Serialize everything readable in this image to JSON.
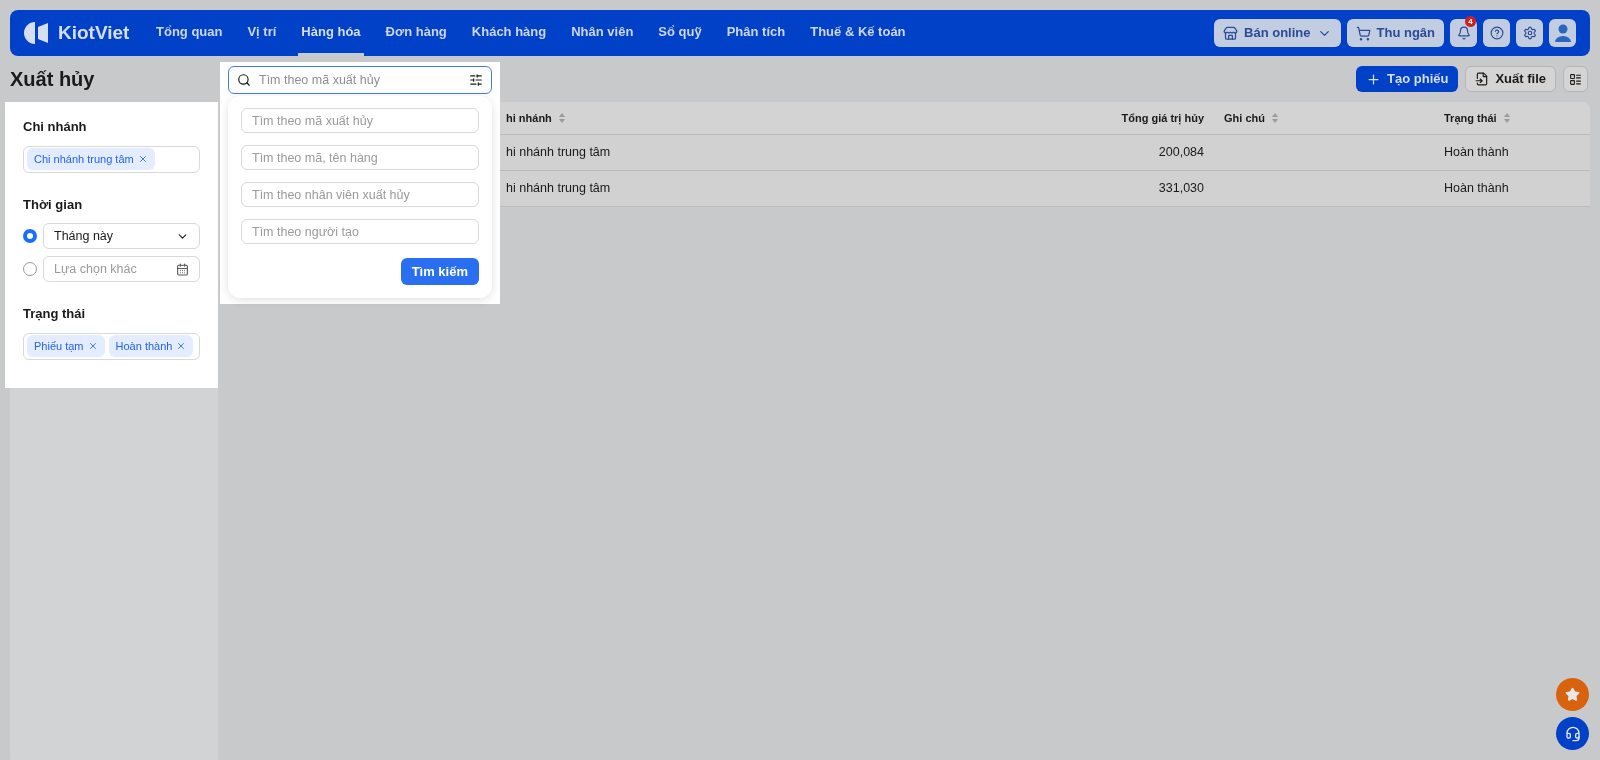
{
  "header": {
    "logo": "KiotViet",
    "nav": [
      {
        "label": "Tổng quan",
        "selected": false
      },
      {
        "label": "Vị trí",
        "selected": false
      },
      {
        "label": "Hàng hóa",
        "selected": true
      },
      {
        "label": "Đơn hàng",
        "selected": false
      },
      {
        "label": "Khách hàng",
        "selected": false
      },
      {
        "label": "Nhân viên",
        "selected": false
      },
      {
        "label": "Sổ quỹ",
        "selected": false
      },
      {
        "label": "Phân tích",
        "selected": false
      },
      {
        "label": "Thuế & Kế toán",
        "selected": false
      }
    ],
    "online_button": "Bán online",
    "cashier_button": "Thu ngân",
    "notification_count": "4"
  },
  "page_title": "Xuất hủy",
  "actions": {
    "create": "Tạo phiếu",
    "export": "Xuất file"
  },
  "filters": {
    "branch": {
      "label": "Chi nhánh",
      "tags": [
        "Chi nhánh trung tâm"
      ]
    },
    "time": {
      "label": "Thời gian",
      "options": [
        {
          "kind": "select",
          "value": "Tháng này",
          "selected": true
        },
        {
          "kind": "date",
          "placeholder": "Lựa chọn khác",
          "selected": false
        }
      ]
    },
    "status": {
      "label": "Trạng thái",
      "tags": [
        "Phiếu tạm",
        "Hoàn thành"
      ]
    }
  },
  "search_popup": {
    "search": {
      "placeholder": "Tìm theo mã xuất hủy"
    },
    "fields": [
      {
        "placeholder": "Tìm theo mã xuất hủy"
      },
      {
        "placeholder": "Tìm theo mã, tên hàng"
      },
      {
        "placeholder": "Tìm theo nhân viên xuất hủy"
      },
      {
        "placeholder": "Tìm theo người tạo"
      }
    ],
    "button": "Tìm kiếm"
  },
  "table": {
    "columns": [
      {
        "label": "hi nhánh",
        "kind": "text",
        "sortable": true
      },
      {
        "label": "Tổng giá trị hủy",
        "kind": "number",
        "sortable": false
      },
      {
        "label": "Ghi chú",
        "kind": "text",
        "sortable": true
      },
      {
        "label": "Trạng thái",
        "kind": "text",
        "sortable": true
      }
    ],
    "rows": [
      {
        "branch": "hi nhánh trung tâm",
        "total": "200,084",
        "status": "Hoàn thành"
      },
      {
        "branch": "hi nhánh trung tâm",
        "total": "331,030",
        "status": "Hoàn thành"
      }
    ]
  }
}
